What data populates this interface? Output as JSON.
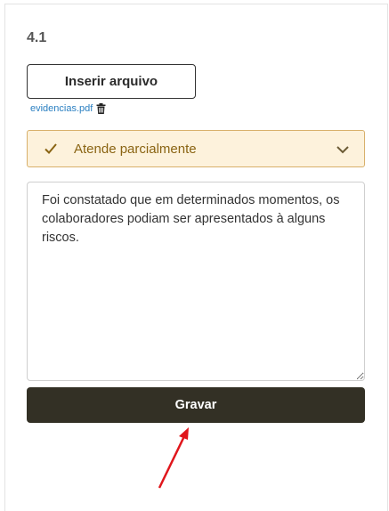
{
  "section": {
    "number": "4.1"
  },
  "upload": {
    "button_label": "Inserir arquivo"
  },
  "attachment": {
    "filename": "evidencias.pdf",
    "link_color": "#2a7fc1",
    "delete_icon": "trash-icon"
  },
  "status": {
    "selected": "Atende parcialmente",
    "icon": "check-icon",
    "dropdown_icon": "chevron-down-icon",
    "background": "#fdf2dc",
    "border": "#d8b06b",
    "text_color": "#8a6413"
  },
  "comment": {
    "value": "Foi constatado que em determinados momentos, os colaboradores podiam ser apresentados à alguns riscos."
  },
  "save": {
    "button_label": "Gravar",
    "background": "#333025"
  },
  "annotation": {
    "icon": "red-arrow-icon",
    "color": "#e0161c"
  }
}
